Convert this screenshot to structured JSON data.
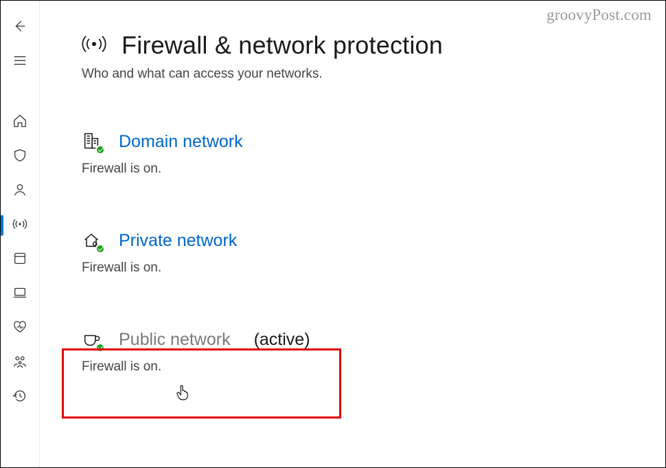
{
  "watermark": "groovyPost.com",
  "page": {
    "title": "Firewall & network protection",
    "subtitle": "Who and what can access your networks."
  },
  "sections": {
    "domain": {
      "label": "Domain network",
      "status": "Firewall is on."
    },
    "private": {
      "label": "Private network",
      "status": "Firewall is on."
    },
    "public": {
      "label": "Public network",
      "suffix": "(active)",
      "status": "Firewall is on."
    }
  }
}
